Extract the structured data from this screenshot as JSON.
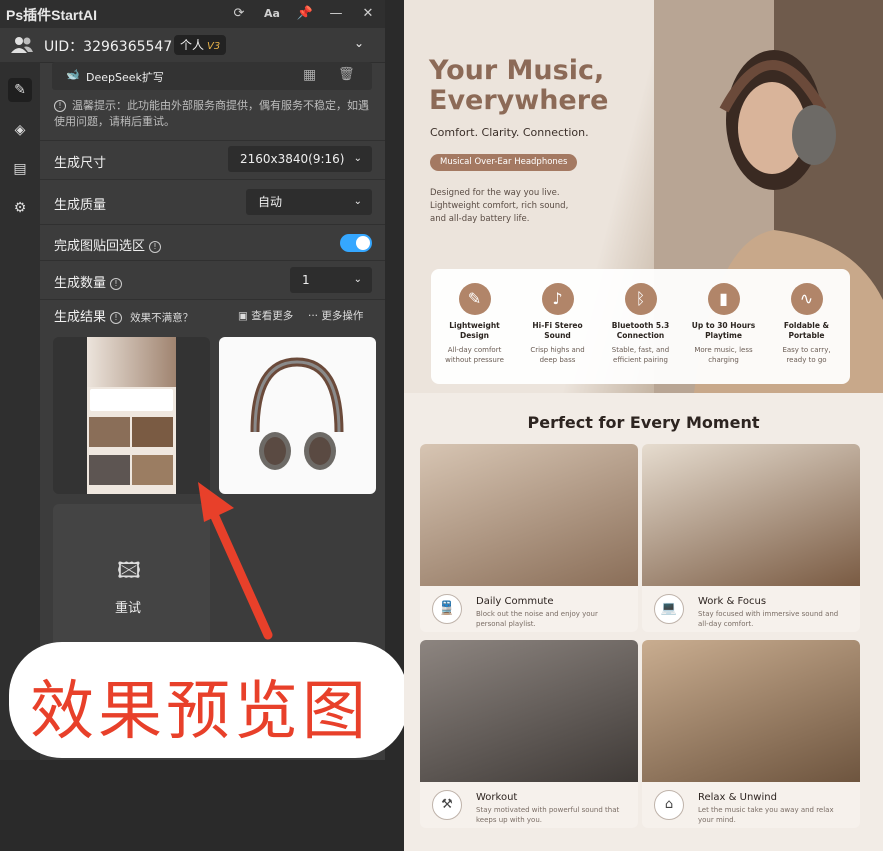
{
  "plugin": {
    "title": "Ps插件StartAI",
    "uid": "UID：3296365547",
    "badge": "个人",
    "badge_level": "V3",
    "deepseek": "DeepSeek扩写",
    "hint": "温馨提示：此功能由外部服务商提供，偶有服务不稳定，如遇使用问题，请稍后重试。",
    "size_label": "生成尺寸",
    "size_value": "2160x3840(9:16)",
    "quality_label": "生成质量",
    "quality_value": "自动",
    "paste_label": "完成图贴回选区",
    "count_label": "生成数量",
    "count_value": "1",
    "results_label": "生成结果",
    "unsatisfied": "效果不满意？",
    "view_more": "查看更多",
    "more_actions": "··· 更多操作",
    "retry": "重试"
  },
  "annotation": {
    "text": "效果预览图",
    "color": "#e8402a"
  },
  "poster": {
    "title_line1": "Your Music,",
    "title_line2": "Everywhere",
    "subtitle": "Comfort. Clarity. Connection.",
    "pill": "Musical Over-Ear Headphones",
    "desc_line1": "Designed for the way you live.",
    "desc_line2": "Lightweight comfort, rich sound,",
    "desc_line3": "and all-day battery life.",
    "features": [
      {
        "icon": "feather-icon",
        "glyph": "✎",
        "title1": "Lightweight",
        "title2": "Design",
        "d1": "All-day comfort",
        "d2": "without pressure"
      },
      {
        "icon": "music-note-icon",
        "glyph": "♪",
        "title1": "Hi-Fi Stereo",
        "title2": "Sound",
        "d1": "Crisp highs and",
        "d2": "deep bass"
      },
      {
        "icon": "bluetooth-icon",
        "glyph": "ᛒ",
        "title1": "Bluetooth 5.3",
        "title2": "Connection",
        "d1": "Stable, fast, and",
        "d2": "efficient pairing"
      },
      {
        "icon": "battery-icon",
        "glyph": "▮",
        "title1": "Up to 30 Hours",
        "title2": "Playtime",
        "d1": "More music, less",
        "d2": "charging"
      },
      {
        "icon": "fold-icon",
        "glyph": "∿",
        "title1": "Foldable &",
        "title2": "Portable",
        "d1": "Easy to carry,",
        "d2": "ready to go"
      }
    ],
    "section_title": "Perfect for Every Moment",
    "cards": [
      {
        "title": "Daily Commute",
        "desc": "Block out the noise and enjoy your personal playlist.",
        "icon": "train-icon",
        "glyph": "🚆",
        "bg": "#8a6e58"
      },
      {
        "title": "Work & Focus",
        "desc": "Stay focused with immersive sound and all-day comfort.",
        "icon": "laptop-icon",
        "glyph": "💻",
        "bg": "#7a5b43"
      },
      {
        "title": "Workout",
        "desc": "Stay motivated with powerful sound that keeps up with you.",
        "icon": "dumbbell-icon",
        "glyph": "⚒",
        "bg": "#5d5552"
      },
      {
        "title": "Relax & Unwind",
        "desc": "Let the music take you away and relax your mind.",
        "icon": "home-icon",
        "glyph": "⌂",
        "bg": "#9b7d62"
      }
    ]
  }
}
